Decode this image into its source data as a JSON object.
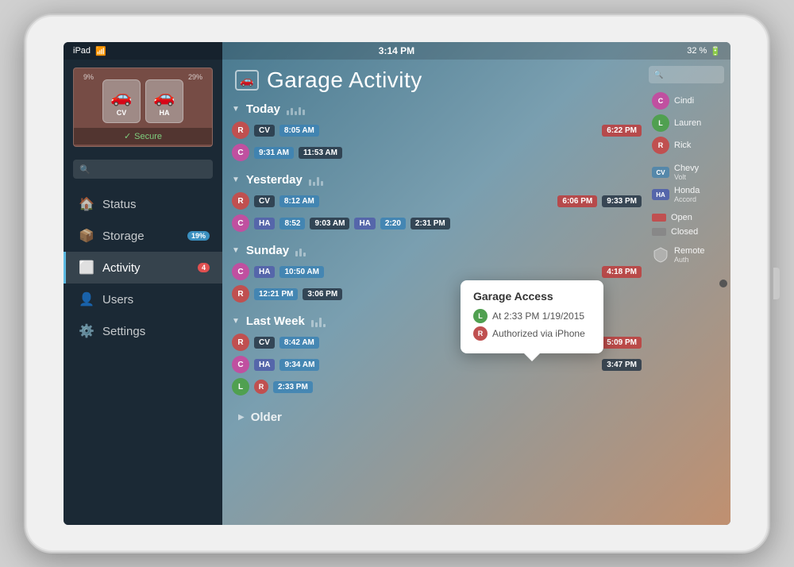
{
  "device": {
    "model": "iPad",
    "time": "3:14 PM",
    "battery": "32 %",
    "wifi_icon": "wifi"
  },
  "sidebar": {
    "search_placeholder": "Search",
    "garage": {
      "secure_label": "Secure",
      "pct_left": "9%",
      "pct_right": "29%",
      "car1_label": "CV",
      "car2_label": "HA"
    },
    "nav_items": [
      {
        "id": "status",
        "label": "Status",
        "icon": "🏠",
        "badge": null,
        "active": false
      },
      {
        "id": "storage",
        "label": "Storage",
        "icon": "📦",
        "badge": "19%",
        "badge_color": "blue",
        "active": false
      },
      {
        "id": "activity",
        "label": "Activity",
        "icon": "🔲",
        "badge": "4",
        "badge_color": "red",
        "active": true
      },
      {
        "id": "users",
        "label": "Users",
        "icon": "👤",
        "badge": null,
        "active": false
      },
      {
        "id": "settings",
        "label": "Settings",
        "icon": "⚙️",
        "badge": null,
        "active": false
      }
    ]
  },
  "main": {
    "title": "Garage Activity",
    "garage_icon": "🚗"
  },
  "legend": {
    "people": [
      {
        "initial": "C",
        "name": "Cindi",
        "color": "#c050a0"
      },
      {
        "initial": "L",
        "name": "Lauren",
        "color": "#50a050"
      },
      {
        "initial": "R",
        "name": "Rick",
        "color": "#c05050"
      }
    ],
    "vehicles": [
      {
        "label": "CV",
        "name": "Chevy Volt",
        "color": "#5588aa"
      },
      {
        "label": "HA",
        "name": "Honda Accord",
        "color": "#5566aa"
      }
    ],
    "statuses": [
      {
        "label": "Open",
        "color": "#c05050"
      },
      {
        "label": "Closed",
        "color": "#888"
      }
    ],
    "remote": {
      "label1": "Remote",
      "label2": "Auth"
    }
  },
  "days": [
    {
      "label": "Today",
      "expanded": true,
      "rows": [
        {
          "user": "R",
          "user_color": "#c05050",
          "events": [
            {
              "label": "CV",
              "type": "vehicle",
              "color": "#5588aa",
              "tag": null
            },
            {
              "label": "8:05 AM",
              "type": "time",
              "color": "blue"
            },
            {
              "label": "6:22 PM",
              "type": "time",
              "color": "red"
            }
          ]
        },
        {
          "user": "C",
          "user_color": "#c050a0",
          "events": [
            {
              "label": "9:31 AM",
              "type": "time",
              "color": "blue"
            },
            {
              "label": "11:53 AM",
              "type": "time",
              "color": "dark"
            }
          ]
        }
      ]
    },
    {
      "label": "Yesterday",
      "expanded": true,
      "rows": [
        {
          "user": "R",
          "user_color": "#c05050",
          "events": [
            {
              "label": "CV",
              "type": "vehicle",
              "color": "#5588aa"
            },
            {
              "label": "8:12 AM",
              "type": "time",
              "color": "blue"
            },
            {
              "label": "6:06 PM",
              "type": "time",
              "color": "red"
            },
            {
              "label": "9:33 PM",
              "type": "time",
              "color": "dark"
            }
          ]
        },
        {
          "user": "C",
          "user_color": "#c050a0",
          "events": [
            {
              "label": "HA",
              "type": "vehicle-sm",
              "color": "#5566aa"
            },
            {
              "label": "8:52",
              "type": "time",
              "color": "blue"
            },
            {
              "label": "9:03 AM",
              "type": "time",
              "color": "dark"
            },
            {
              "label": "HA",
              "type": "vehicle-sm",
              "color": "#5566aa"
            },
            {
              "label": "2:20",
              "type": "time",
              "color": "blue"
            },
            {
              "label": "2:31 PM",
              "type": "time",
              "color": "dark"
            }
          ]
        }
      ]
    },
    {
      "label": "Sunday",
      "expanded": true,
      "rows": [
        {
          "user": "C",
          "user_color": "#c050a0",
          "events": [
            {
              "label": "HA",
              "type": "vehicle-sm",
              "color": "#5566aa"
            },
            {
              "label": "10:50 AM",
              "type": "time",
              "color": "blue"
            },
            {
              "label": "4:18 PM",
              "type": "time",
              "color": "red"
            }
          ]
        },
        {
          "user": "R",
          "user_color": "#c05050",
          "events": [
            {
              "label": "12:21 PM",
              "type": "time",
              "color": "blue"
            },
            {
              "label": "3:06 PM",
              "type": "time",
              "color": "dark"
            }
          ]
        }
      ]
    },
    {
      "label": "Last Week",
      "expanded": true,
      "rows": [
        {
          "user": "R",
          "user_color": "#c05050",
          "events": [
            {
              "label": "CV",
              "type": "vehicle",
              "color": "#5588aa"
            },
            {
              "label": "8:42 AM",
              "type": "time",
              "color": "blue"
            },
            {
              "label": "5:09 PM",
              "type": "time",
              "color": "red"
            }
          ]
        },
        {
          "user": "C",
          "user_color": "#c050a0",
          "events": [
            {
              "label": "HA",
              "type": "vehicle-sm",
              "color": "#5566aa"
            },
            {
              "label": "9:34 AM",
              "type": "time",
              "color": "blue"
            },
            {
              "label": "3:47 PM",
              "type": "time",
              "color": "dark"
            }
          ]
        },
        {
          "user": "L",
          "user_color": "#50a050",
          "events": [
            {
              "label": "R",
              "type": "user-inline",
              "color": "#c05050"
            },
            {
              "label": "2:33 PM",
              "type": "time",
              "color": "blue"
            }
          ]
        }
      ]
    }
  ],
  "popup": {
    "title": "Garage Access",
    "line1_icon": "L",
    "line1_color": "#50a050",
    "line1_text": "At 2:33 PM  1/19/2015",
    "line2_icon": "R",
    "line2_color": "#c05050",
    "line2_text": "Authorized via iPhone"
  },
  "older": {
    "label": "Older"
  }
}
